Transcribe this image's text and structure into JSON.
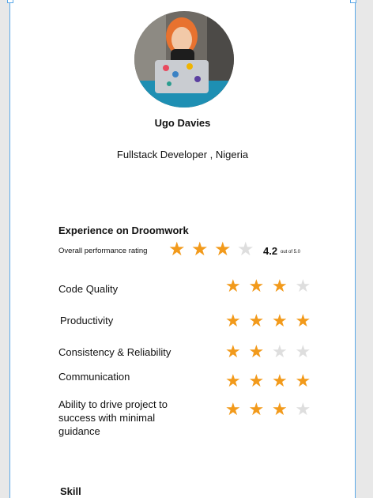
{
  "profile": {
    "name": "Ugo Davies",
    "role": "Fullstack Developer , Nigeria"
  },
  "experience": {
    "title": "Experience on Droomwork",
    "overall_label": "Overall performance rating",
    "overall_value": "4.2",
    "overall_suffix": "out of 5.0",
    "overall_stars_filled": 3,
    "overall_stars_total": 4
  },
  "categories": [
    {
      "label": "Code Quality",
      "stars_filled": 3,
      "stars_total": 4
    },
    {
      "label": "Productivity",
      "stars_filled": 4,
      "stars_total": 4
    },
    {
      "label": "Consistency & Reliability",
      "stars_filled": 2,
      "stars_total": 4
    },
    {
      "label": "Communication",
      "stars_filled": 4,
      "stars_total": 4
    },
    {
      "label": "Ability to drive project to success with minimal guidance",
      "stars_filled": 3,
      "stars_total": 4
    }
  ],
  "skill": {
    "title": "Skill"
  },
  "colors": {
    "star_filled": "#f29a1b",
    "star_empty": "#dedede",
    "selection_border": "#5aa8e8"
  },
  "icons": {
    "star": "star-icon"
  }
}
